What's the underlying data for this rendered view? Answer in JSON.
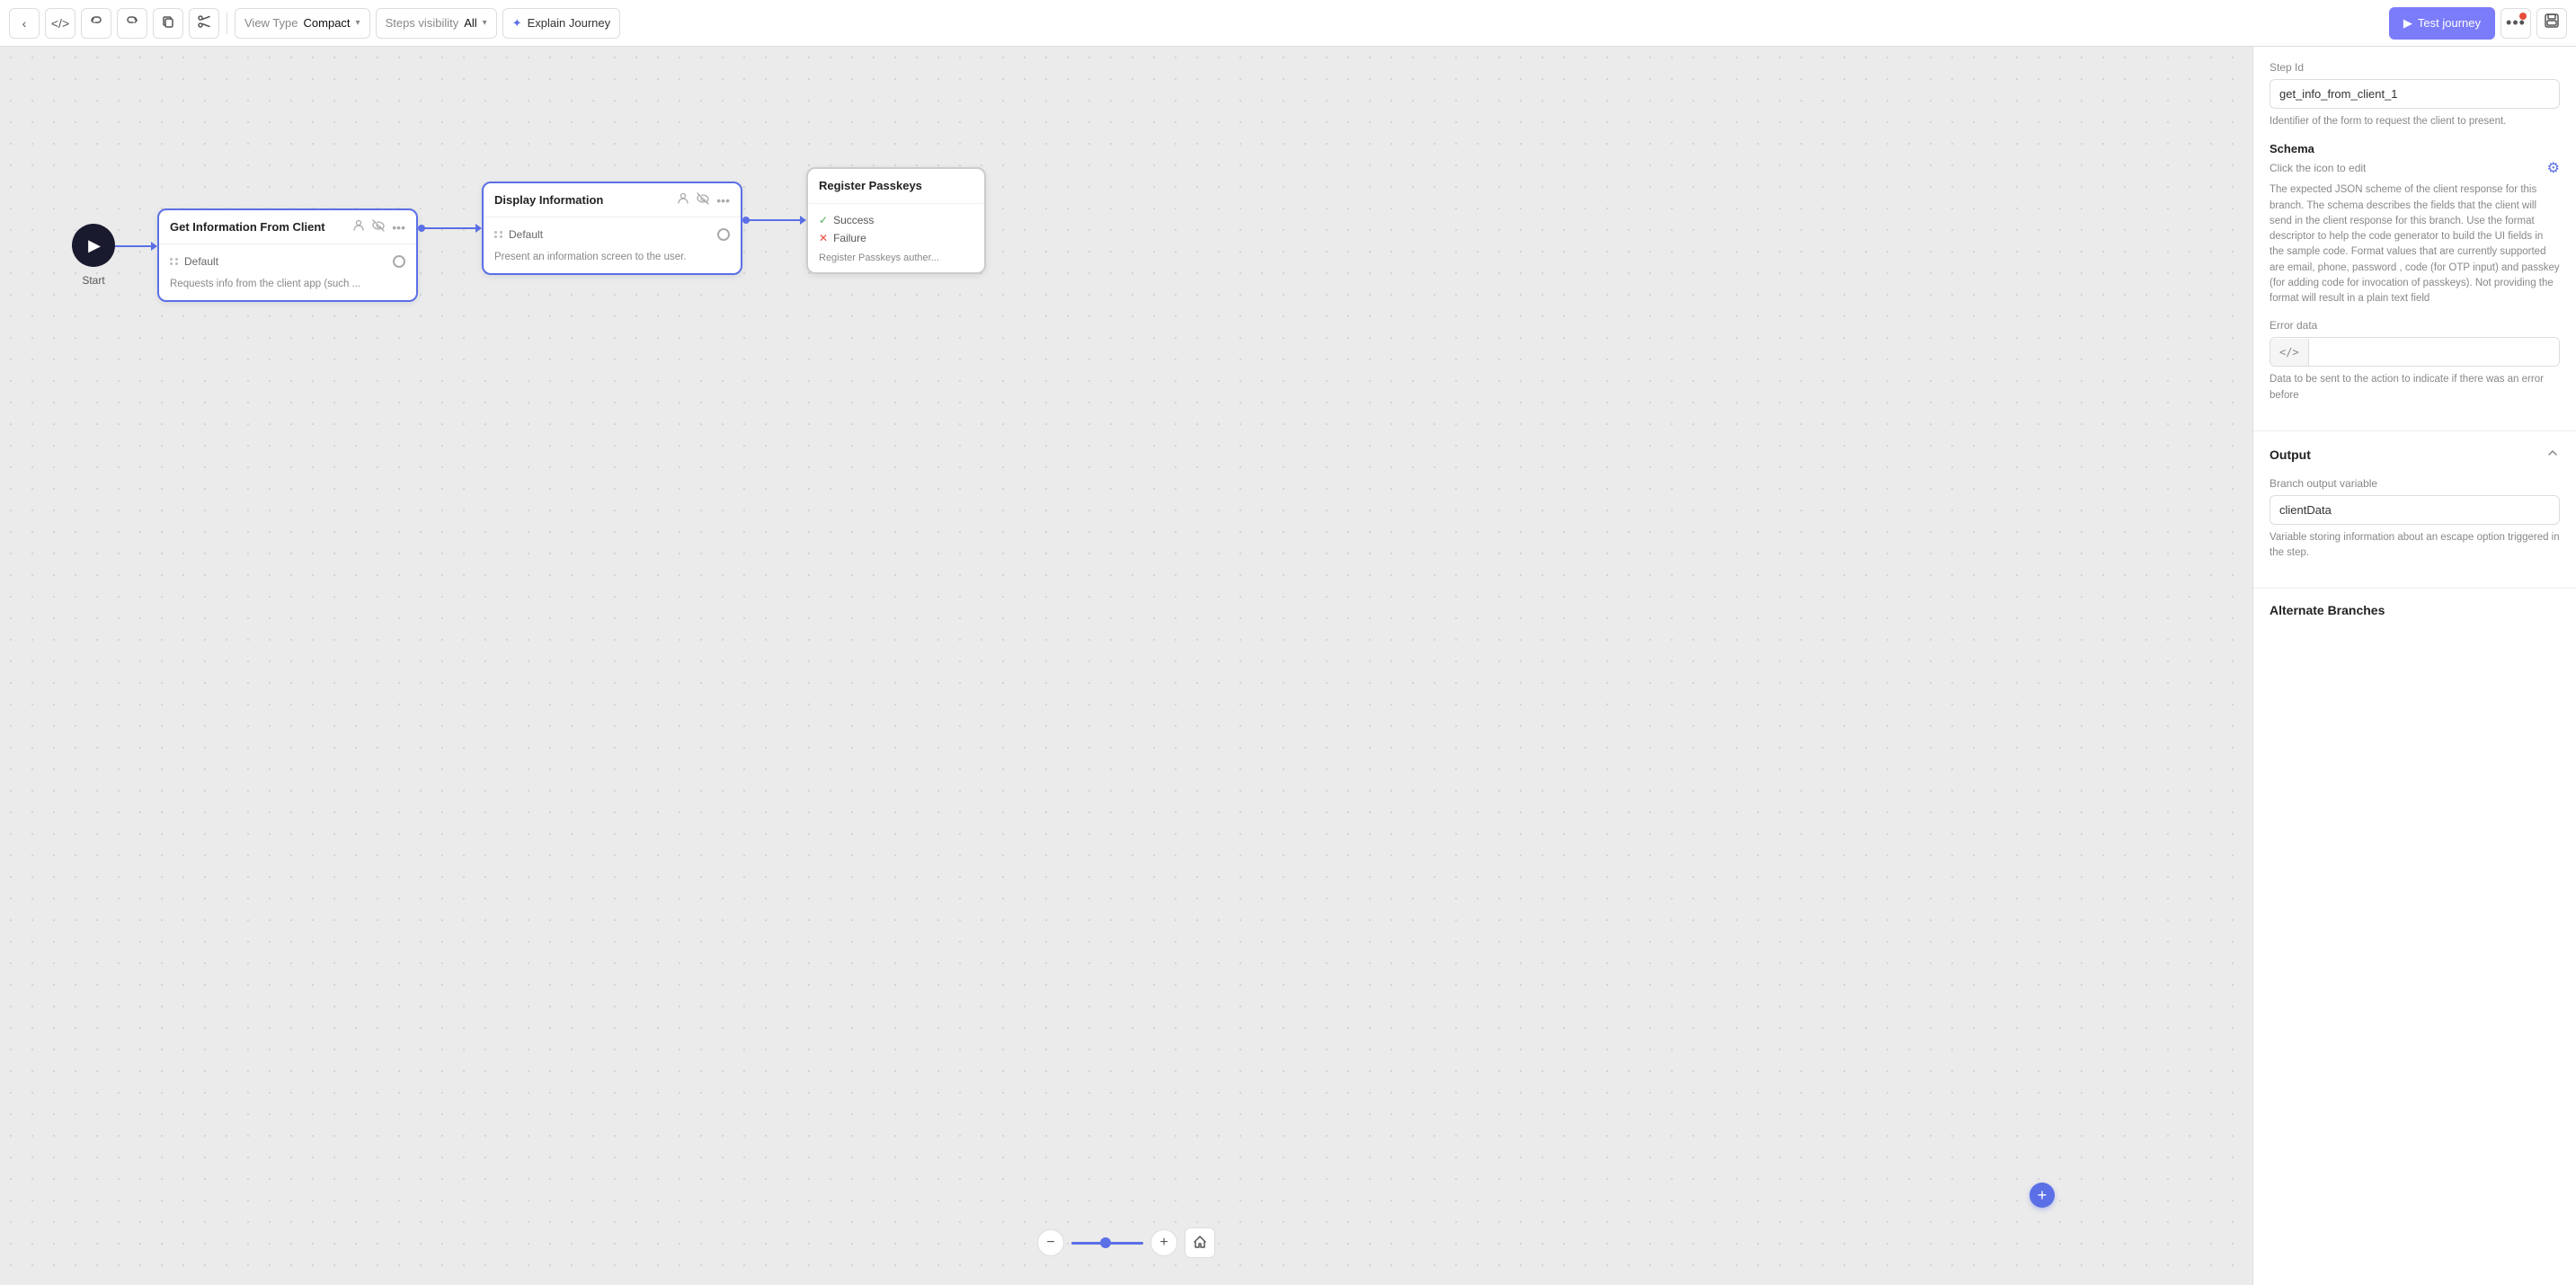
{
  "toolbar": {
    "back_label": "‹",
    "code_label": "</>",
    "undo_label": "↩",
    "redo_label": "↪",
    "copy_label": "⧉",
    "scissors_label": "✂",
    "view_type_label": "View Type",
    "view_type_value": "Compact",
    "steps_visibility_label": "Steps visibility",
    "steps_visibility_value": "All",
    "explain_journey_label": "Explain Journey",
    "test_journey_label": "Test journey",
    "more_label": "⋯",
    "save_label": "💾"
  },
  "canvas": {
    "start_label": "Start",
    "nodes": [
      {
        "id": "get-info",
        "title": "Get Information From Client",
        "branch": "Default",
        "description": "Requests info from the client app (such ..."
      },
      {
        "id": "display-info",
        "title": "Display Information",
        "branch": "Default",
        "description": "Present an information screen to the user."
      },
      {
        "id": "register-passkeys",
        "title": "Register Passkeys",
        "branches": [
          "Success",
          "Failure"
        ],
        "description": "Register Passkeys auther..."
      }
    ]
  },
  "right_panel": {
    "step_id_label": "Step Id",
    "step_id_value": "get_info_from_client_1",
    "step_id_desc": "Identifier of the form to request the client to present.",
    "schema_label": "Schema",
    "schema_click_text": "Click the icon to edit",
    "schema_desc": "The expected JSON scheme of the client response for this branch. The schema describes the fields that the client will send in the client response for this branch. Use the format descriptor to help the code generator to build the UI fields in the sample code. Format values that are currently supported are email, phone, password , code (for OTP input) and passkey (for adding code for invocation of passkeys). Not providing the format will result in a plain text field",
    "error_data_label": "Error data",
    "error_data_placeholder": "",
    "error_data_desc": "Data to be sent to the action to indicate if there was an error before",
    "output_label": "Output",
    "branch_output_label": "Branch output variable",
    "branch_output_value": "clientData",
    "branch_output_desc": "Variable storing information about an escape option triggered in the step.",
    "alternate_branches_label": "Alternate Branches"
  }
}
